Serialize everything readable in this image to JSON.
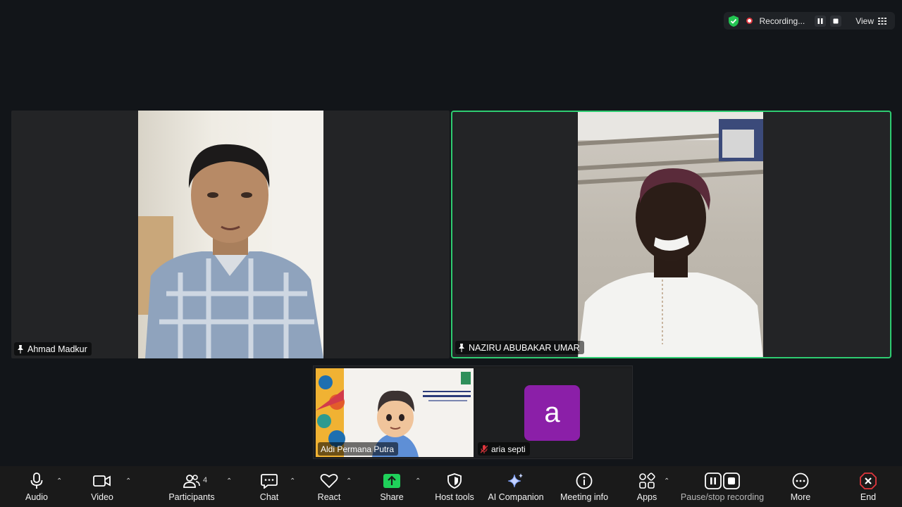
{
  "recording": {
    "status_label": "Recording...",
    "view_label": "View"
  },
  "participants": {
    "main_left_name": "Ahmad Madkur",
    "main_right_name": "NAZIRU ABUBAKAR UMAR",
    "thumb_1_name": "Aldi Permana Putra",
    "thumb_2_name": "aria septi",
    "thumb_2_initial": "a",
    "count": "4"
  },
  "toolbar": {
    "audio": "Audio",
    "video": "Video",
    "participants": "Participants",
    "chat": "Chat",
    "react": "React",
    "share": "Share",
    "host_tools": "Host tools",
    "ai_companion": "AI Companion",
    "meeting_info": "Meeting info",
    "apps": "Apps",
    "pause_stop_recording": "Pause/stop recording",
    "more": "More",
    "end": "End"
  },
  "colors": {
    "active_speaker_border": "#2ecc71",
    "share_green": "#1fd15a",
    "end_red": "#e0363d",
    "avatar_purple": "#8b1fa8"
  }
}
